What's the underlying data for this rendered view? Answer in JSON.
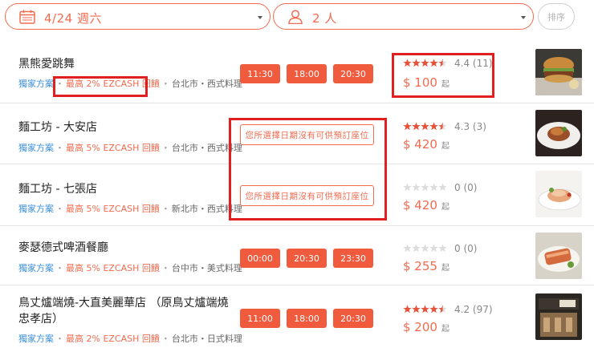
{
  "filters": {
    "date": "4/24 週六",
    "people": "2 人",
    "sort_label": "排序"
  },
  "restaurants": [
    {
      "name": "黑熊愛跳舞",
      "exclusive": "獨家方案",
      "cashback": "最高 2% EZCASH 回饋",
      "location": "台北市・西式料理",
      "times": [
        "11:30",
        "18:00",
        "20:30"
      ],
      "rating": "4.4 (11)",
      "stars": 4.5,
      "price": "$ 100",
      "price_suffix": "起"
    },
    {
      "name": "麵工坊 - 大安店",
      "exclusive": "獨家方案",
      "cashback": "最高 5% EZCASH 回饋",
      "location": "台北市・西式料理",
      "no_slot": "您所選擇日期沒有可供預訂座位",
      "rating": "4.3 (3)",
      "stars": 4.5,
      "price": "$ 420",
      "price_suffix": "起"
    },
    {
      "name": "麵工坊 - 七張店",
      "exclusive": "獨家方案",
      "cashback": "最高 5% EZCASH 回饋",
      "location": "新北市・西式料理",
      "no_slot": "您所選擇日期沒有可供預訂座位",
      "rating": "0 (0)",
      "stars": 0,
      "price": "$ 420",
      "price_suffix": "起"
    },
    {
      "name": "麥瑟德式啤酒餐廳",
      "exclusive": "獨家方案",
      "cashback": "最高 5% EZCASH 回饋",
      "location": "台中市・美式料理",
      "times": [
        "00:00",
        "20:30",
        "23:30"
      ],
      "rating": "0 (0)",
      "stars": 0,
      "price": "$ 255",
      "price_suffix": "起"
    },
    {
      "name_line1": "鳥丈爐端燒-大直美麗華店 （原鳥丈爐端燒",
      "name_line2": "忠孝店）",
      "exclusive": "獨家方案",
      "cashback": "最高 2% EZCASH 回饋",
      "location": "台北市・日式料理",
      "times": [
        "11:00",
        "18:00",
        "20:30"
      ],
      "rating": "4.2 (97)",
      "stars": 4.5,
      "price": "$ 200",
      "price_suffix": "起"
    }
  ],
  "colors": {
    "accent": "#f05a3d",
    "link": "#3b8fd8",
    "highlight": "#e02020"
  }
}
